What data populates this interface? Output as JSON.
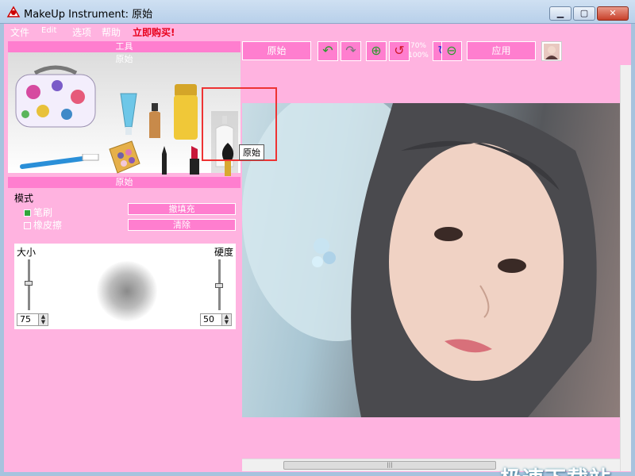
{
  "window": {
    "title": "MakeUp Instrument: 原始",
    "minimize": "▁",
    "maximize": "▢",
    "close": "✕"
  },
  "menu": {
    "file": "文件",
    "edit": "Edit",
    "options": "选项",
    "help": "帮助",
    "buy": "立即购买!"
  },
  "tools_panel": {
    "header": "工具",
    "subheader": "原始",
    "selected_tool_tooltip": "原始"
  },
  "mode_panel": {
    "header": "原始",
    "mode_label": "模式",
    "brush_option": "笔刷",
    "eraser_option": "橡皮擦",
    "brush_selected": true,
    "fill_button": "撤填充",
    "clear_button": "清除",
    "size_label": "大小",
    "hardness_label": "硬度",
    "size_value": "75",
    "hardness_value": "50"
  },
  "toolbar": {
    "original_button": "原始",
    "apply_button": "应用",
    "zoom_text_top": "70%",
    "zoom_text_bottom": "100%"
  },
  "watermark": "极速下载站",
  "colors": {
    "panel": "#ffb3e0",
    "header": "#ff7ecf",
    "highlight": "#e33333"
  }
}
